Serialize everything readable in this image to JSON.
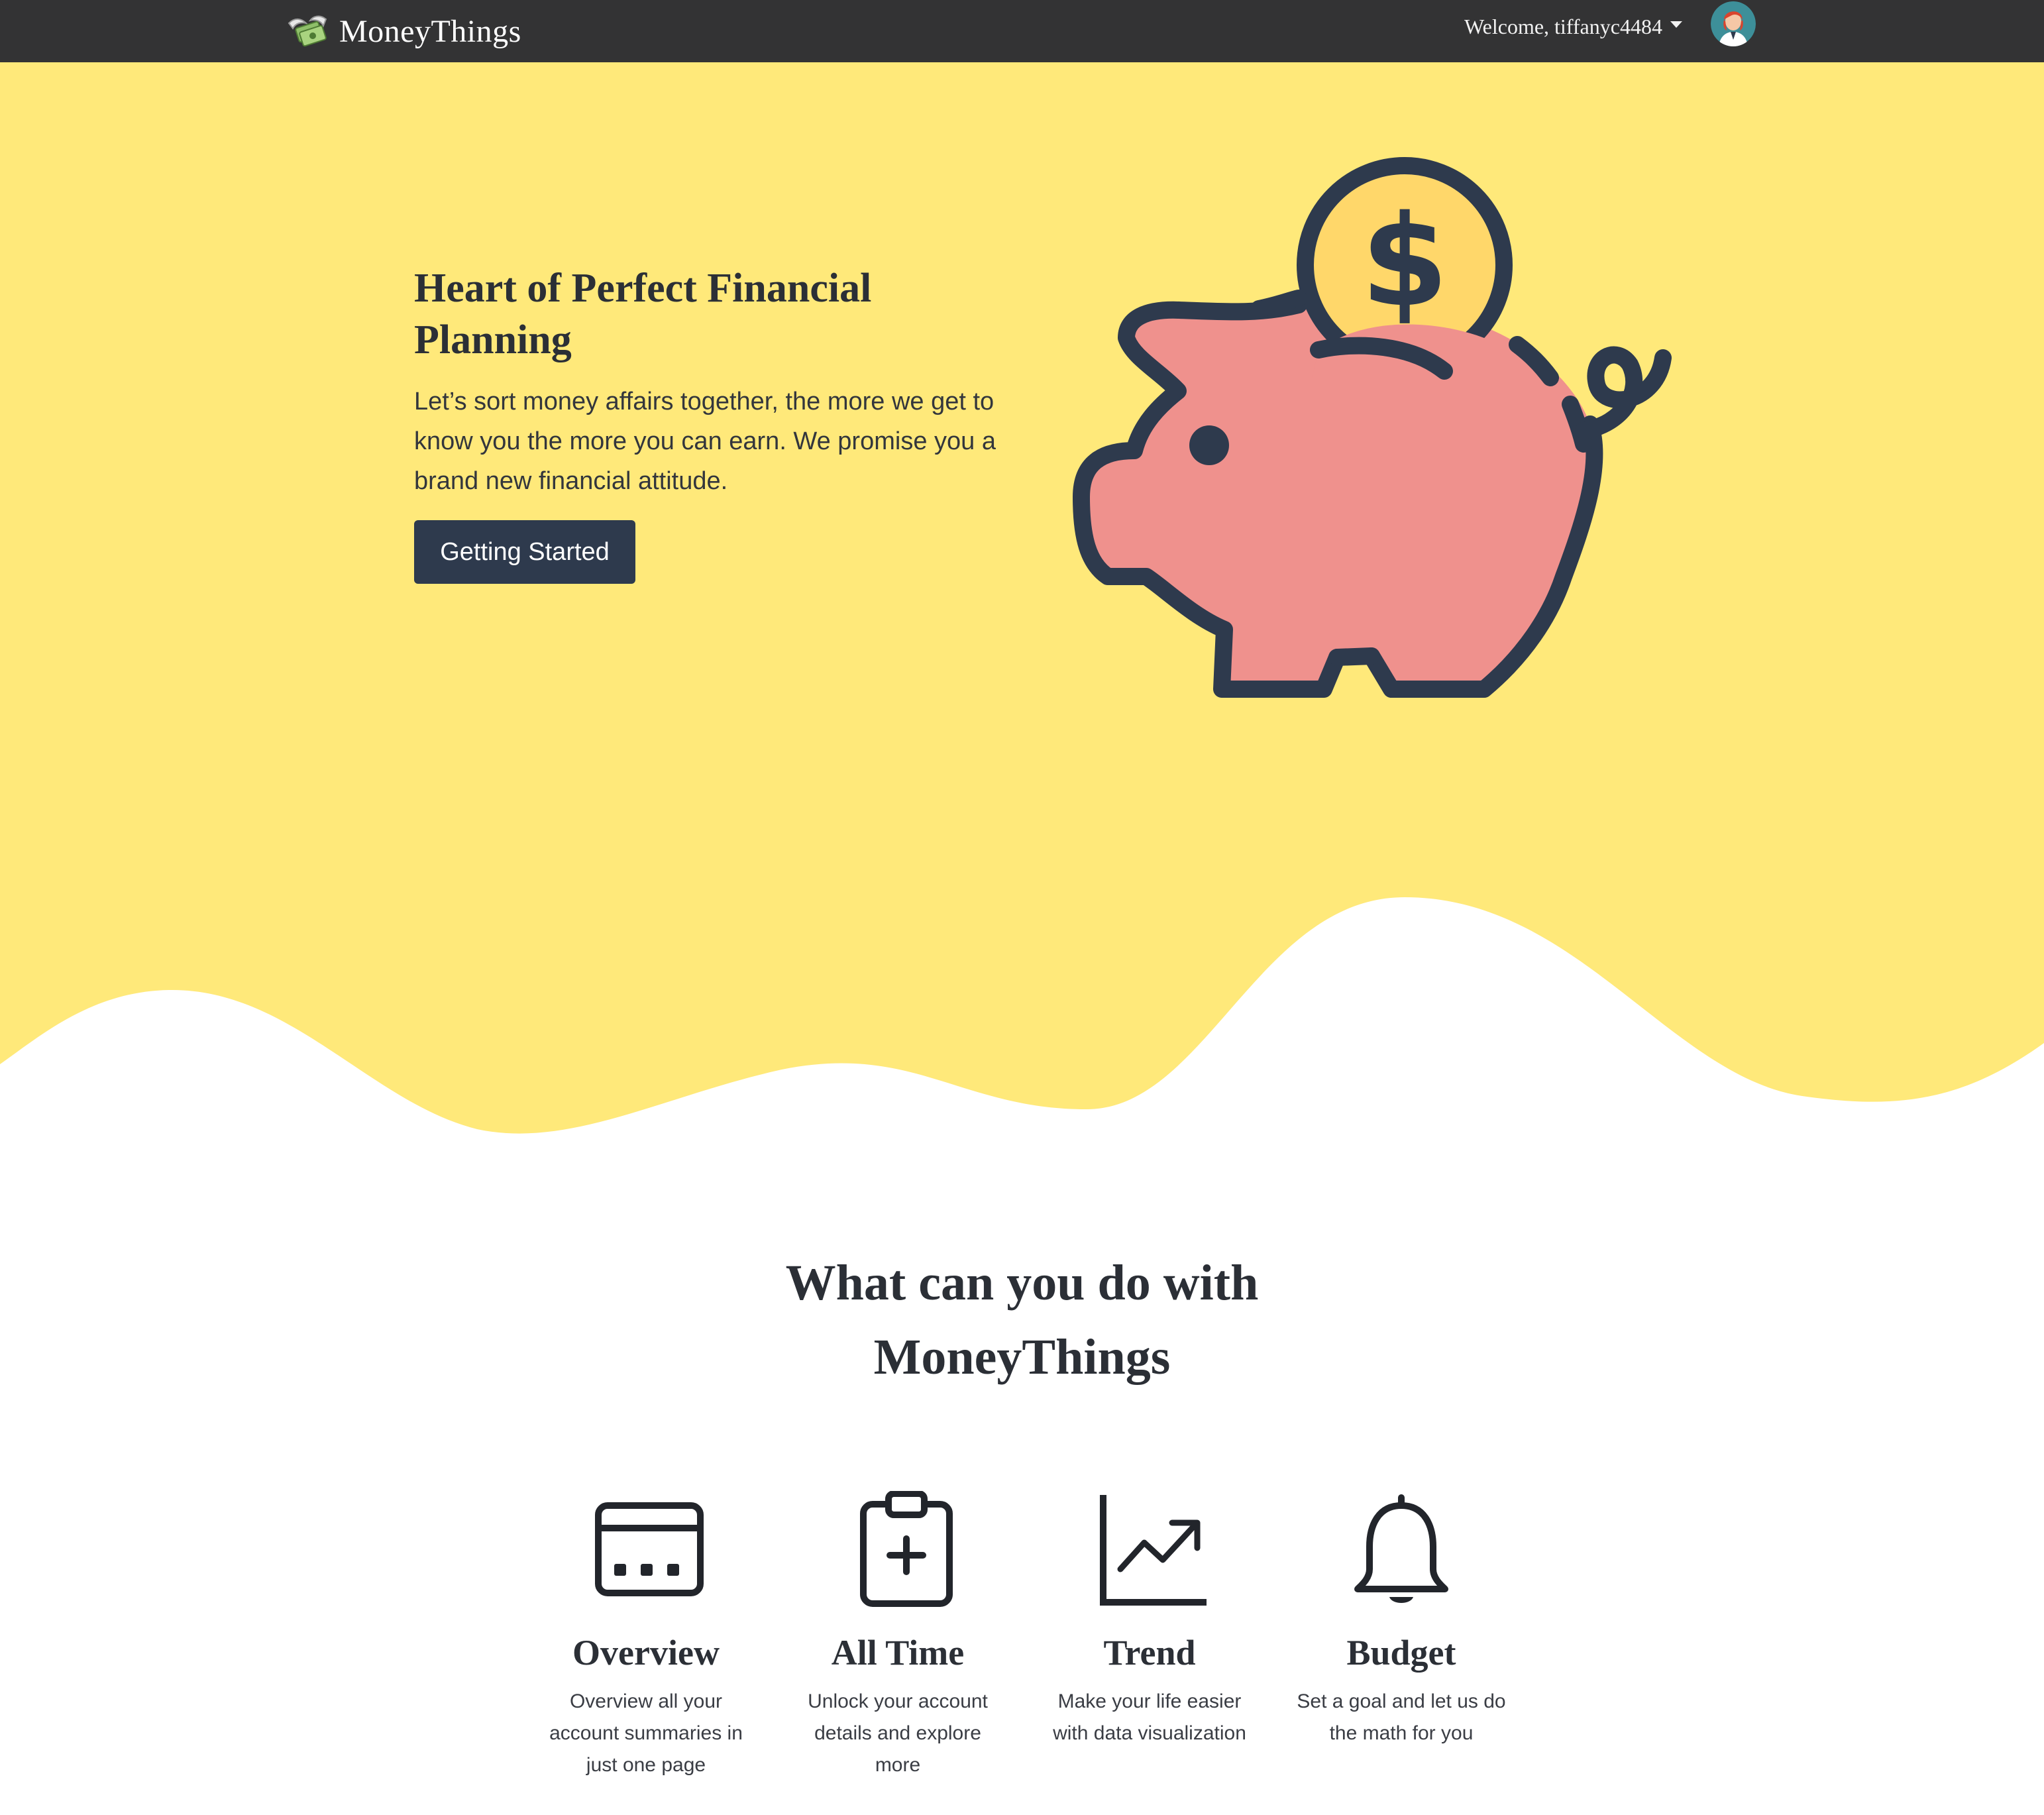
{
  "colors": {
    "navbar": "#333334",
    "hero_yellow": "#FFE97A",
    "button": "#2E3A4D",
    "piggy_pink": "#EF918D",
    "coin": "#FFD76A",
    "outline": "#2E3A4D"
  },
  "navbar": {
    "brand_name": "MoneyThings",
    "brand_icon": "money-with-wings-icon",
    "welcome": "Welcome, tiffanyc4484",
    "avatar_icon": "user-avatar"
  },
  "hero": {
    "title": "Heart of Perfect Financial Planning",
    "description": "Let’s sort money affairs together, the more we get to know you the more you can earn. We promise you a brand new financial attitude.",
    "button_label": "Getting Started",
    "illustration": "piggy-bank-icon"
  },
  "features_section": {
    "title_line1": "What can you do with",
    "title_line2": "MoneyThings",
    "items": [
      {
        "icon": "overview-window-icon",
        "title": "Overview",
        "description": "Overview all your account summaries in just one page"
      },
      {
        "icon": "clipboard-plus-icon",
        "title": "All Time",
        "description": "Unlock your account details and explore more"
      },
      {
        "icon": "trend-chart-icon",
        "title": "Trend",
        "description": "Make your life easier with data visualization"
      },
      {
        "icon": "bell-icon",
        "title": "Budget",
        "description": "Set a goal and let us do the math for you"
      }
    ]
  }
}
